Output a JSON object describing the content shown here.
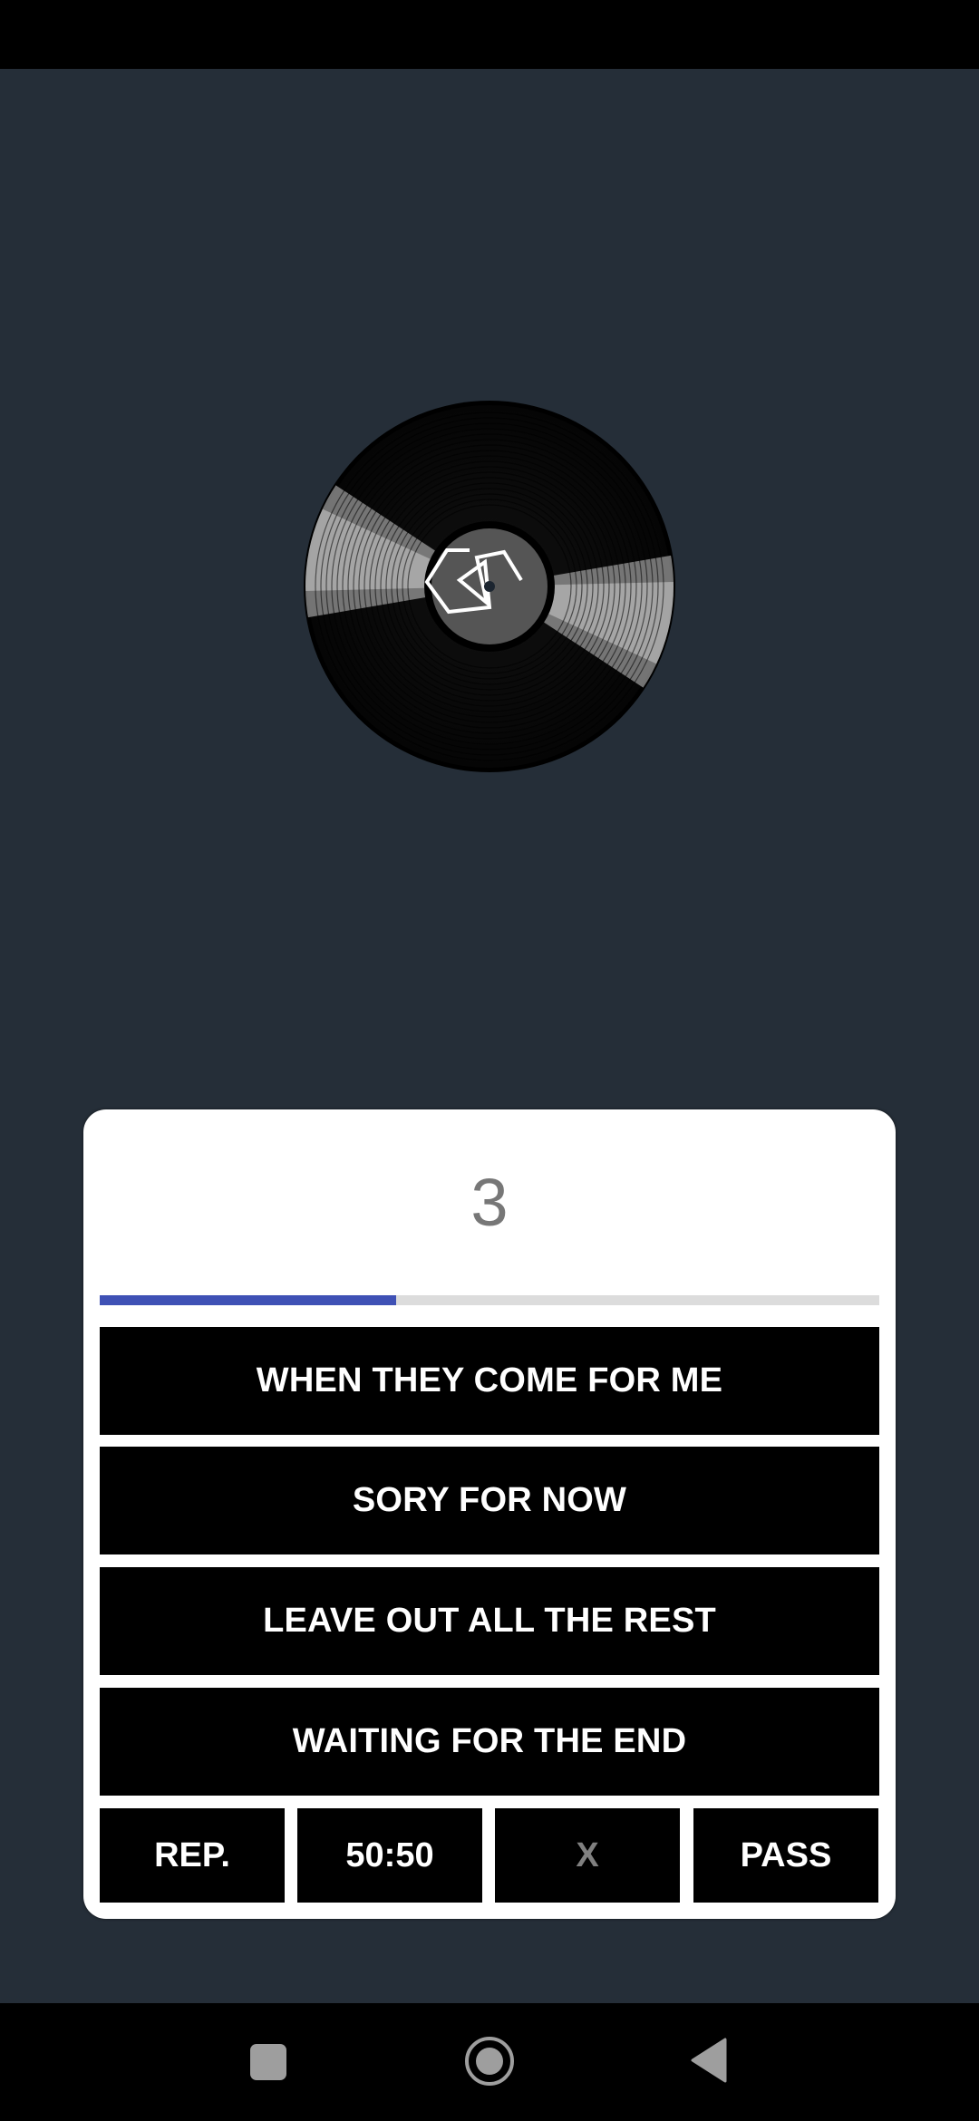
{
  "app": {
    "background_color": "#252e38",
    "accent_color": "#3f51b5"
  },
  "status_bar": {},
  "record": {
    "icon": "vinyl-record-icon",
    "label_logo": "geometric-logo-icon"
  },
  "quiz": {
    "countdown": "3",
    "progress": {
      "fraction": 0.38,
      "fill_color": "#3f51b5",
      "track_color": "#dcdcdc"
    },
    "answers": [
      {
        "label": "WHEN THEY COME FOR ME"
      },
      {
        "label": "SORY FOR NOW"
      },
      {
        "label": "LEAVE OUT ALL THE REST"
      },
      {
        "label": "WAITING FOR THE END"
      }
    ],
    "tools": [
      {
        "label": "REP.",
        "enabled": true
      },
      {
        "label": "50:50",
        "enabled": true
      },
      {
        "label": "X",
        "enabled": false
      },
      {
        "label": "PASS",
        "enabled": true
      }
    ]
  },
  "nav_bar": {
    "recents_icon": "square-recents-icon",
    "home_icon": "circle-home-icon",
    "back_icon": "triangle-back-icon"
  }
}
